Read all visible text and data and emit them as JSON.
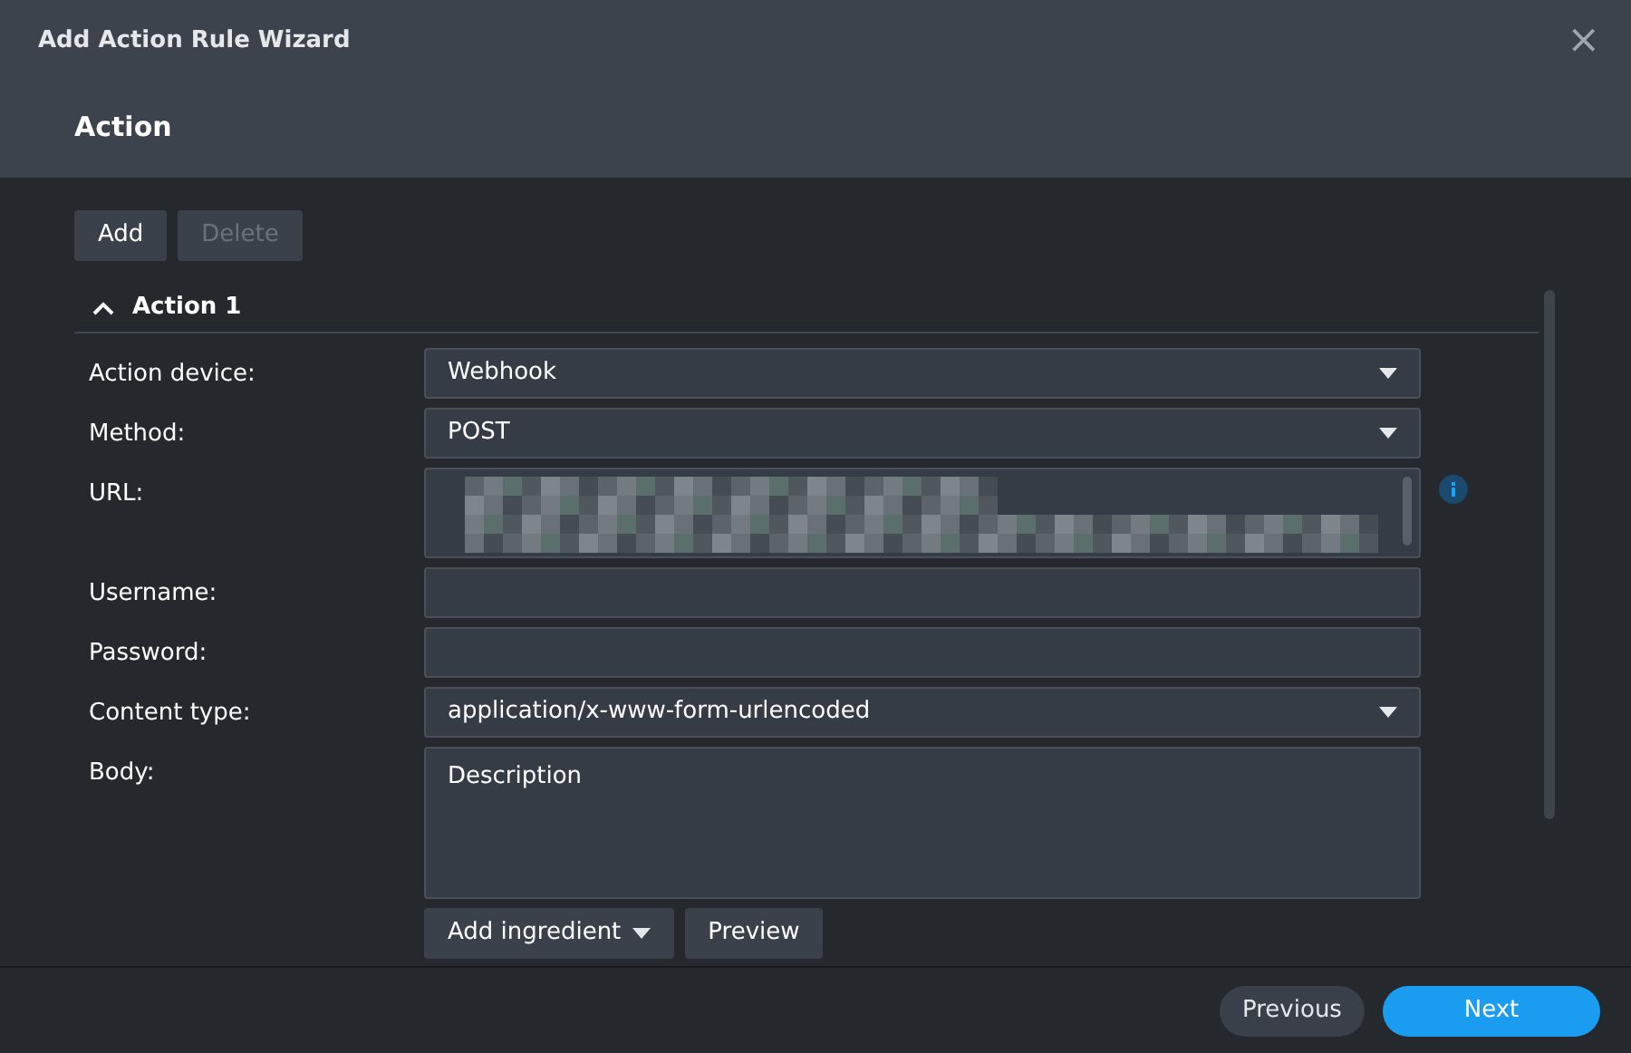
{
  "window": {
    "title": "Add Action Rule Wizard",
    "close": "×"
  },
  "step_title": "Action",
  "toolbar": [
    {
      "label": "Add",
      "disabled": false
    },
    {
      "label": "Delete",
      "disabled": true
    }
  ],
  "section": {
    "title": "Action 1",
    "expanded": true
  },
  "fields": [
    {
      "label": "Action device:",
      "kind": "select",
      "value": "Webhook"
    },
    {
      "label": "Method:",
      "kind": "select",
      "value": "POST"
    },
    {
      "label": "URL:",
      "kind": "redacted",
      "info": true
    },
    {
      "label": "Username:",
      "kind": "text"
    },
    {
      "label": "Password:",
      "kind": "text"
    },
    {
      "label": "Content type:",
      "kind": "select",
      "value": "application/x-www-form-urlencoded"
    },
    {
      "label": "Body:",
      "kind": "textarea",
      "placeholder": "Description"
    }
  ],
  "body_buttons": [
    {
      "label": "Add ingredient",
      "dropdown": true
    },
    {
      "label": "Preview",
      "dropdown": false
    }
  ],
  "footer": [
    {
      "label": "Previous",
      "kind": "secondary"
    },
    {
      "label": "Next",
      "kind": "primary"
    }
  ]
}
